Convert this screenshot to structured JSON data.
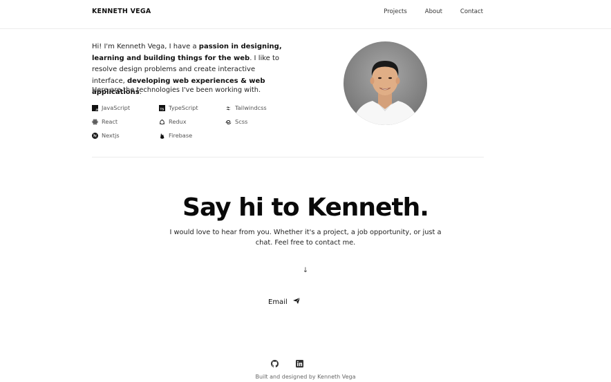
{
  "nav": {
    "brand": "KENNETH VEGA",
    "links": [
      "Projects",
      "About",
      "Contact"
    ]
  },
  "intro": {
    "p1": "Hi! I'm Kenneth Vega, I have a ",
    "b1": "passion in designing, learning and building things for the web",
    "p2": ". I like to resolve design problems and create interactive interface, ",
    "b2": "developing web experiences & web applications",
    "p3": ".",
    "tech_title": "Here are the technologies I've been working with."
  },
  "technologies": [
    {
      "label": "JavaScript",
      "icon": "javascript-icon"
    },
    {
      "label": "TypeScript",
      "icon": "typescript-icon"
    },
    {
      "label": "Tailwindcss",
      "icon": "tailwind-icon"
    },
    {
      "label": "React",
      "icon": "react-icon"
    },
    {
      "label": "Redux",
      "icon": "redux-icon"
    },
    {
      "label": "Scss",
      "icon": "sass-icon"
    },
    {
      "label": "Nextjs",
      "icon": "nextjs-icon"
    },
    {
      "label": "Firebase",
      "icon": "firebase-icon"
    }
  ],
  "contact": {
    "heading": "Say hi to Kenneth.",
    "subtext": "I would love to hear from you. Whether it's a project, a job opportunity, or just a chat. Feel free to contact me.",
    "arrow": "↓",
    "email_label": "Email"
  },
  "footer": {
    "credit": "Built and designed by Kenneth Vega",
    "socials": [
      "github-icon",
      "linkedin-icon"
    ]
  }
}
